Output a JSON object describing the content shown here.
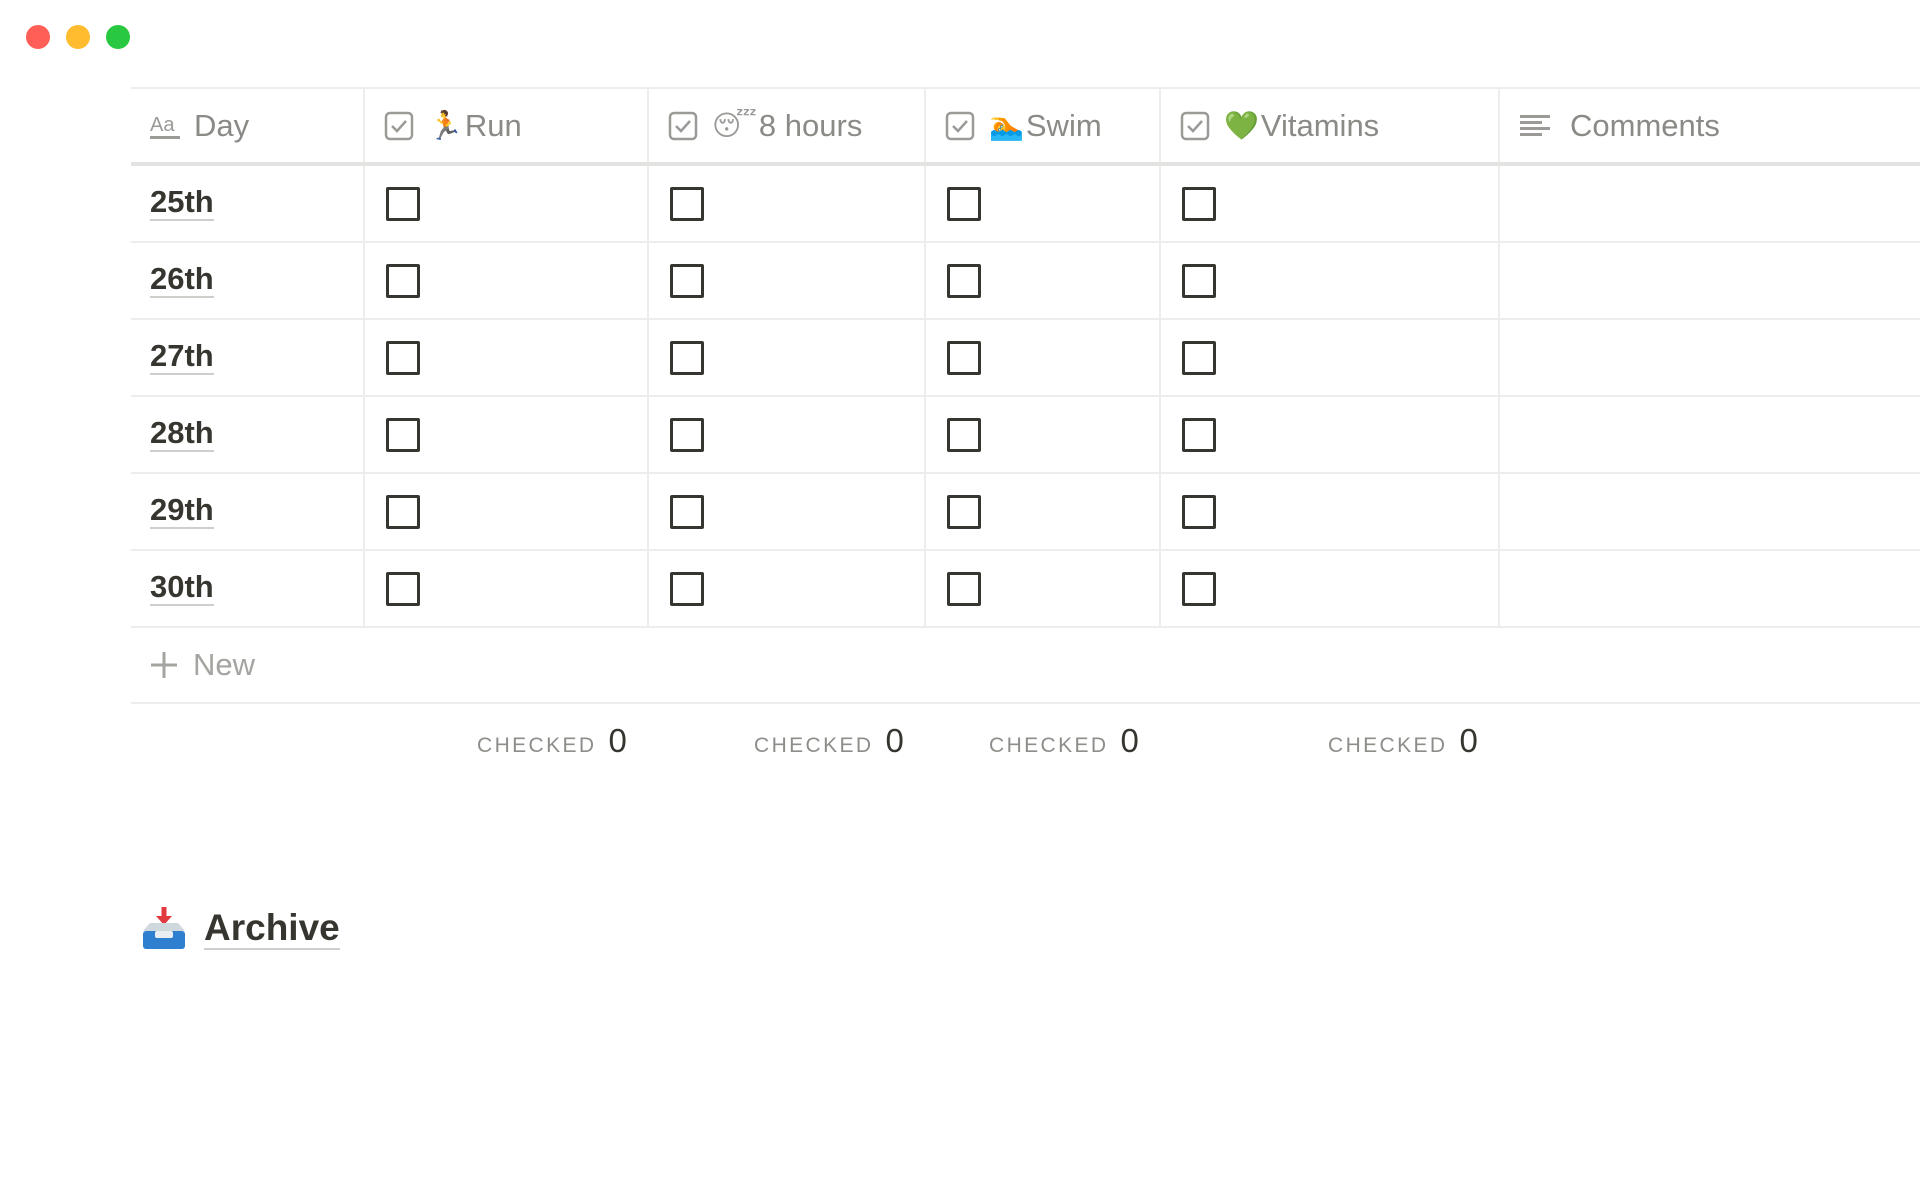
{
  "window": {
    "controls": [
      "close",
      "minimize",
      "maximize"
    ]
  },
  "table": {
    "columns": [
      {
        "label": "Day",
        "icon": "text-type-icon"
      },
      {
        "label": "Run",
        "icon": "checkbox-property-icon",
        "emoji": "🏃"
      },
      {
        "label": "8 hours",
        "icon": "checkbox-property-icon",
        "emoji": "😴"
      },
      {
        "label": "Swim",
        "icon": "checkbox-property-icon",
        "emoji": "🏊"
      },
      {
        "label": "Vitamins",
        "icon": "checkbox-property-icon",
        "emoji": "💚"
      },
      {
        "label": "Comments",
        "icon": "text-lines-icon"
      }
    ],
    "rows": [
      {
        "day": "25th",
        "run": false,
        "sleep": false,
        "swim": false,
        "vitamins": false,
        "comments": ""
      },
      {
        "day": "26th",
        "run": false,
        "sleep": false,
        "swim": false,
        "vitamins": false,
        "comments": ""
      },
      {
        "day": "27th",
        "run": false,
        "sleep": false,
        "swim": false,
        "vitamins": false,
        "comments": ""
      },
      {
        "day": "28th",
        "run": false,
        "sleep": false,
        "swim": false,
        "vitamins": false,
        "comments": ""
      },
      {
        "day": "29th",
        "run": false,
        "sleep": false,
        "swim": false,
        "vitamins": false,
        "comments": ""
      },
      {
        "day": "30th",
        "run": false,
        "sleep": false,
        "swim": false,
        "vitamins": false,
        "comments": ""
      }
    ],
    "new_label": "New",
    "calculations": [
      {
        "label": "CHECKED",
        "value": "0"
      },
      {
        "label": "CHECKED",
        "value": "0"
      },
      {
        "label": "CHECKED",
        "value": "0"
      },
      {
        "label": "CHECKED",
        "value": "0"
      }
    ]
  },
  "archive": {
    "title": "Archive",
    "icon": "inbox-tray-icon"
  },
  "colors": {
    "text": "#37352f",
    "muted": "#9b9a97",
    "border": "#ededeb",
    "close": "#ff5f57",
    "minimize": "#febc2e",
    "maximize": "#28c840",
    "heart": "#3dbb61"
  }
}
